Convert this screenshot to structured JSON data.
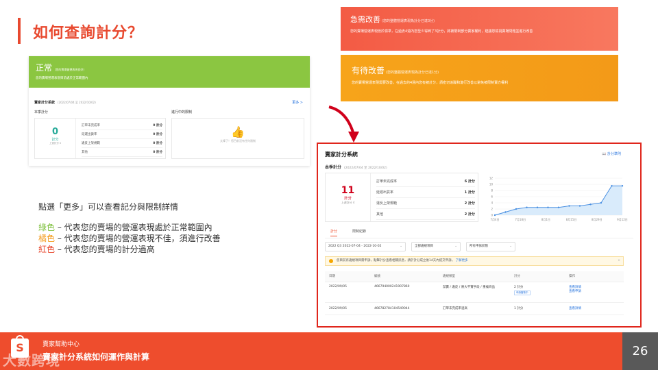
{
  "title": "如何查詢計分？",
  "green_banner": {
    "status": "正常",
    "sub": "(您的賣場營運表現良好)",
    "desc": "您的賣場營運表現目前處於正常範圍內"
  },
  "left_shot": {
    "system": "賣家計分系統",
    "period": "(2022/07/04 至 2022/10/02)",
    "more": "更多 >",
    "quarter_label": "本季計分",
    "limit_label": "進行中的限制",
    "score": "0",
    "unit": "計分",
    "hint": "上週計分 0",
    "rows": [
      {
        "label": "訂單未完成率",
        "value": "0 計分"
      },
      {
        "label": "延遲出貨率",
        "value": "0 計分"
      },
      {
        "label": "違反上架規範",
        "value": "0 計分"
      },
      {
        "label": "其他",
        "value": "0 計分"
      }
    ],
    "empty": "太棒了！您目前沒有任何限制"
  },
  "red_banner": {
    "title": "急需改善",
    "sub": "(您的整體營運表現為計分已達3分)",
    "desc": "您的賣場營運表現低於標準，在過去4週內您至少得到了3計分，將被限制部分賣家權利，建議您檢視賣場問題並進行改善"
  },
  "orange_banner": {
    "title": "有待改善",
    "sub": "(您的整體營運表現為計分已達1分)",
    "desc": "您的賣場營運表現需要改善，在過去的4週內您有被計分，請密切追蹤和進行改善以避免被限制賣方權利"
  },
  "body": {
    "line1": "點選「更多」可以查看記分與限制詳情",
    "green_word": "綠色",
    "green_rest": " – 代表您的賣場的營運表現處於正常範圍內",
    "orange_word": "橘色",
    "orange_rest": " – 代表您的賣場的營運表現不佳，須進行改善",
    "red_word": "紅色",
    "red_rest": " – 代表您的賣場的計分過高"
  },
  "right_shot": {
    "system": "賣家計分系統",
    "guide": "計分準則",
    "quarter_label": "本季計分",
    "period": "(2022/07/04 至 2022/10/02)",
    "score": "11",
    "unit": "計分",
    "hint": "上週計分 4",
    "rows": [
      {
        "label": "訂單未完成率",
        "value": "6 計分"
      },
      {
        "label": "延遲出貨率",
        "value": "1 計分"
      },
      {
        "label": "違反上架規範",
        "value": "2 計分"
      },
      {
        "label": "其他",
        "value": "2 計分"
      }
    ],
    "tabs": [
      "計分",
      "限制紀錄"
    ],
    "filters": [
      "2022 Q3  2022-07-04 - 2022-10-02",
      "全部違規項目",
      "所有申訴狀態"
    ],
    "notice": "您目前有違規項目需申訴，點擊計分查看相關訊息，請於計分成立後14天內提交申訴。",
    "notice_link": "了解更多",
    "table_headers": [
      "日期",
      "編號",
      "違規類型",
      "計分",
      "操作"
    ],
    "table_rows": [
      {
        "date": "2022/09/05",
        "id": "466794000241907860",
        "type": "禁賣 / 違反 / 將大不實手段 / 重複商品",
        "score": "2 計分",
        "tag": "申訴審核中",
        "act1": "查看詳情",
        "act2": "查看申訴"
      },
      {
        "date": "2022/09/05",
        "id": "466782784104549044",
        "type": "訂單未完成率過高",
        "score": "1 計分",
        "tag": "",
        "act1": "查看詳情",
        "act2": ""
      }
    ]
  },
  "footer": {
    "small": "賣家幫助中心",
    "big": "賣家計分系統如何運作與計算",
    "page": "26",
    "watermark": "大數跨境"
  },
  "chart_data": {
    "type": "area",
    "x": [
      "7月4日",
      "7月18日",
      "8月1日",
      "8月15日",
      "8月29日",
      "9月12日"
    ],
    "y_axis_ticks": [
      0,
      2,
      4,
      6,
      8,
      10,
      12
    ],
    "ylim": [
      0,
      12
    ],
    "values": [
      0,
      1,
      2,
      2.5,
      2.5,
      2.5,
      2.5,
      3,
      3,
      3.5,
      4,
      9.5,
      9.5
    ],
    "x_points": 13,
    "grid": true
  }
}
